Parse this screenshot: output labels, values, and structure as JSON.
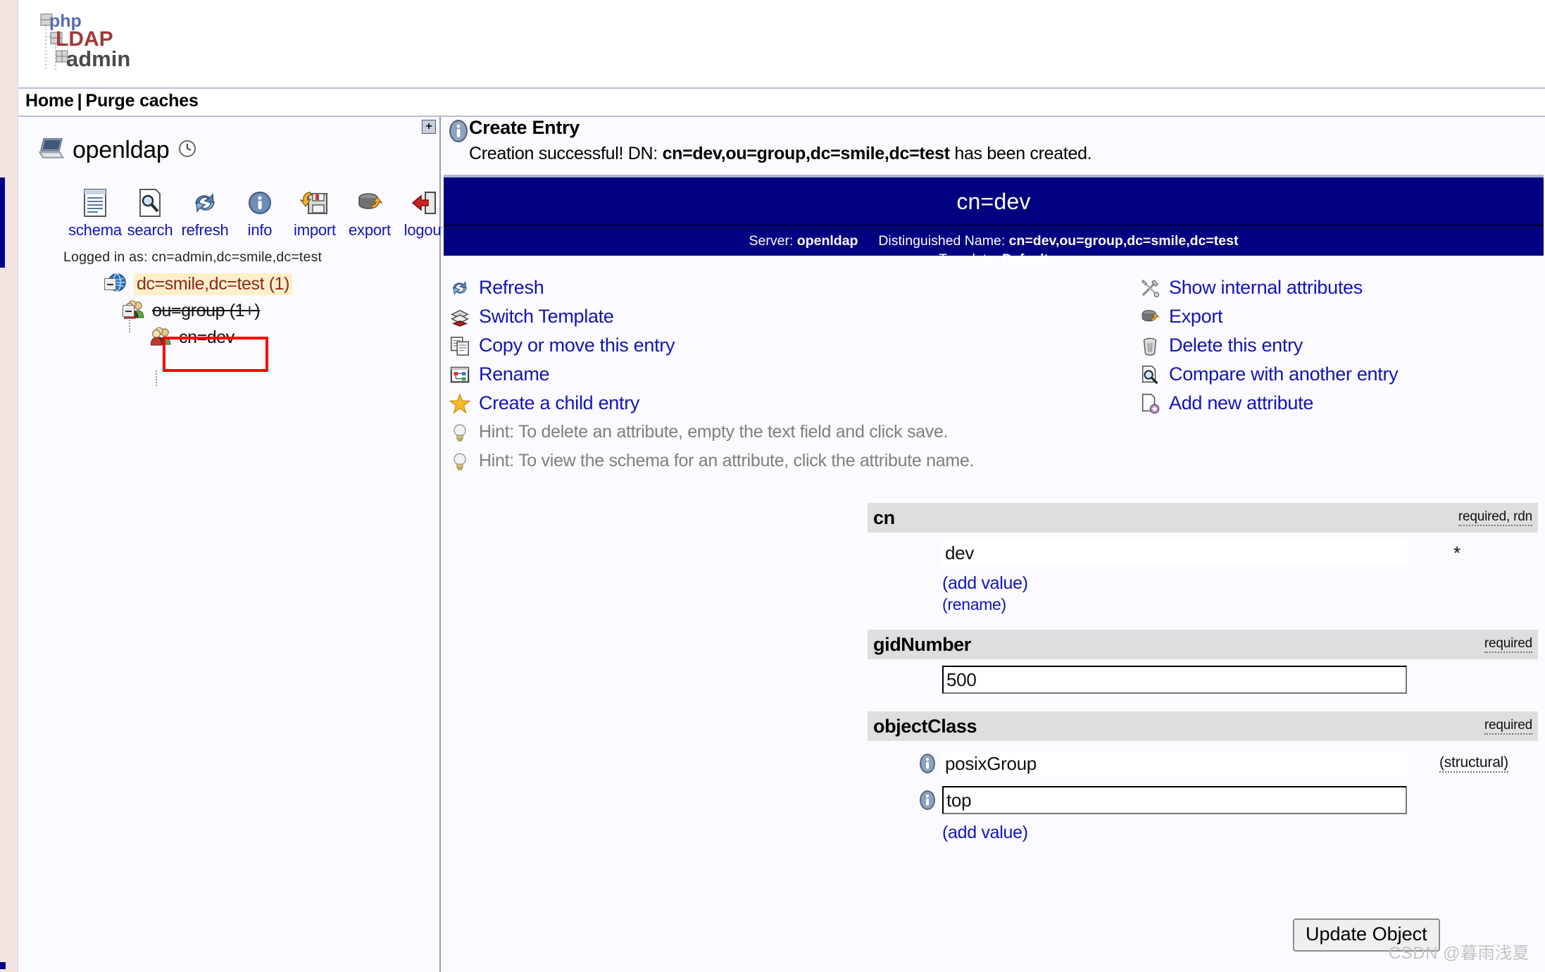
{
  "app": {
    "logo_alt": "phpLDAPadmin",
    "logo_php": "php",
    "logo_ldap": "LDAP",
    "logo_admin": "admin"
  },
  "nav": {
    "home": "Home",
    "separator": "|",
    "purge": "Purge caches"
  },
  "sidebar": {
    "expand_label": "+",
    "server_name": "openldap",
    "logged_in": "Logged in as: cn=admin,dc=smile,dc=test",
    "toolbar": [
      {
        "label": "schema",
        "icon": "schema-icon"
      },
      {
        "label": "search",
        "icon": "search-icon"
      },
      {
        "label": "refresh",
        "icon": "refresh-icon"
      },
      {
        "label": "info",
        "icon": "info-icon"
      },
      {
        "label": "import",
        "icon": "import-icon"
      },
      {
        "label": "export",
        "icon": "export-icon"
      },
      {
        "label": "logout",
        "icon": "logout-icon"
      }
    ],
    "tree": {
      "root": {
        "text": "dc=smile,dc=test (1)",
        "count": "(1)"
      },
      "child": {
        "text": "ou=group (1+)"
      },
      "leaf": {
        "text": "cn=dev"
      }
    }
  },
  "main": {
    "page_title": "Create Entry",
    "message_prefix": "Creation successful! DN:",
    "message_dn": "cn=dev,ou=group,dc=smile,dc=test",
    "message_suffix": "has been created.",
    "banner": {
      "title": "cn=dev",
      "server_label": "Server:",
      "server_value": "openldap",
      "dn_label": "Distinguished Name:",
      "dn_value": "cn=dev,ou=group,dc=smile,dc=test",
      "template_label": "Template:",
      "template_value": "Default"
    },
    "actions_left": [
      {
        "label": "Refresh",
        "icon": "refresh-icon"
      },
      {
        "label": "Switch Template",
        "icon": "switch-template-icon"
      },
      {
        "label": "Copy or move this entry",
        "icon": "copy-icon"
      },
      {
        "label": "Rename",
        "icon": "rename-icon"
      },
      {
        "label": "Create a child entry",
        "icon": "star-icon"
      }
    ],
    "actions_right": [
      {
        "label": "Show internal attributes",
        "icon": "tools-icon"
      },
      {
        "label": "Export",
        "icon": "export-icon"
      },
      {
        "label": "Delete this entry",
        "icon": "trash-icon"
      },
      {
        "label": "Compare with another entry",
        "icon": "compare-icon"
      },
      {
        "label": "Add new attribute",
        "icon": "add-attribute-icon"
      }
    ],
    "hints": [
      {
        "text": "Hint: To delete an attribute, empty the text field and click save.",
        "icon": "lightbulb-icon"
      },
      {
        "text": "Hint: To view the schema for an attribute, click the attribute name.",
        "icon": "lightbulb-icon"
      }
    ],
    "attributes": [
      {
        "name": "cn",
        "flags": "required, rdn",
        "value": "dev",
        "required_marker": "*",
        "add_value": "(add value)",
        "rename": "(rename)"
      },
      {
        "name": "gidNumber",
        "flags": "required",
        "value": "500"
      },
      {
        "name": "objectClass",
        "flags": "required",
        "value_readonly": "posixGroup",
        "structural": "(structural)",
        "value_input": "top",
        "add_value": "(add value)"
      }
    ],
    "update_button": "Update Object"
  },
  "watermark": "CSDN @暮雨浅夏",
  "colors": {
    "banner_blue": "#000080",
    "link_blue": "#1414b4",
    "attr_header_gray": "#dedede",
    "tree_highlight": "#fdf0c8",
    "tree_highlight_text": "#8a2b1d",
    "redbox": "#ff0000",
    "hint_gray": "#7f7f7f"
  }
}
